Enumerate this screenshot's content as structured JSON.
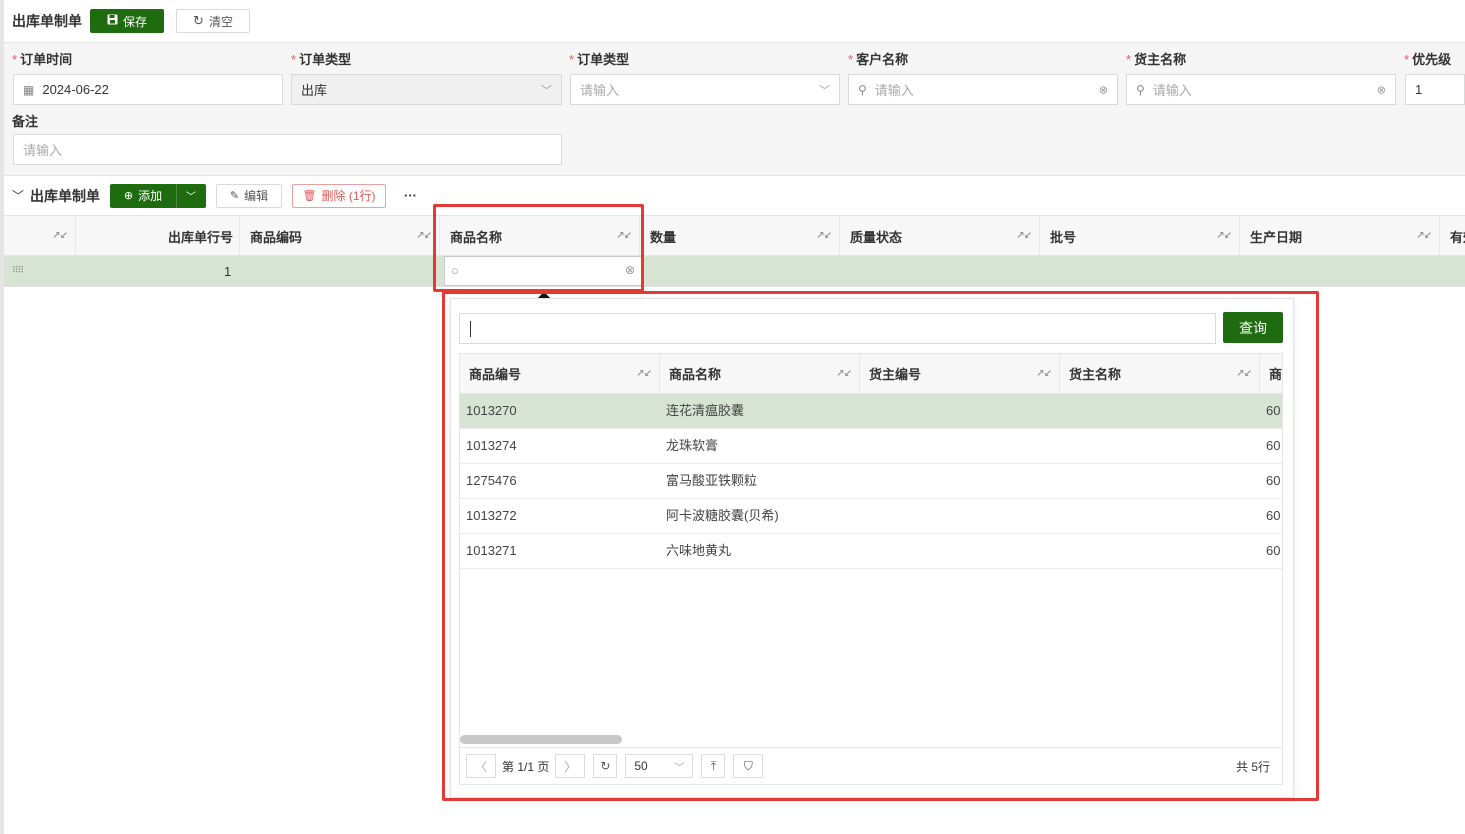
{
  "header": {
    "title": "出库单制单",
    "save_label": "保存",
    "clear_label": "清空"
  },
  "form": {
    "order_time": {
      "label": "订单时间",
      "value": "2024-06-22"
    },
    "order_type": {
      "label": "订单类型",
      "value": "出库"
    },
    "order_type2": {
      "label": "订单类型",
      "placeholder": "请输入"
    },
    "customer": {
      "label": "客户名称",
      "placeholder": "请输入"
    },
    "owner": {
      "label": "货主名称",
      "placeholder": "请输入"
    },
    "priority": {
      "label": "优先级",
      "value": "1"
    },
    "remark": {
      "label": "备注",
      "placeholder": "请输入"
    }
  },
  "detail": {
    "title": "出库单制单",
    "add_label": "添加",
    "edit_label": "编辑",
    "delete_label": "删除 (1行)",
    "more_label": "···"
  },
  "grid": {
    "columns": [
      "出库单行号",
      "商品编码",
      "商品名称",
      "数量",
      "质量状态",
      "批号",
      "生产日期",
      "有效"
    ],
    "row_number": "1"
  },
  "popup": {
    "query_label": "查询",
    "columns": [
      "商品编号",
      "商品名称",
      "货主编号",
      "货主名称",
      "商"
    ],
    "rows": [
      {
        "code": "1013270",
        "name": "连花清瘟胶囊",
        "extra": "60"
      },
      {
        "code": "1013274",
        "name": "龙珠软膏",
        "extra": "60"
      },
      {
        "code": "1275476",
        "name": "富马酸亚铁颗粒",
        "extra": "60"
      },
      {
        "code": "1013272",
        "name": "阿卡波糖胶囊(贝希)",
        "extra": "60"
      },
      {
        "code": "1013271",
        "name": "六味地黄丸",
        "extra": "60"
      }
    ],
    "pager": {
      "page_text": "第 1/1 页",
      "page_size": "50",
      "total_text": "共 5行"
    }
  },
  "colors": {
    "primary": "#1e6b10",
    "selected_row": "#d7e4d3",
    "highlight": "#e53935"
  }
}
